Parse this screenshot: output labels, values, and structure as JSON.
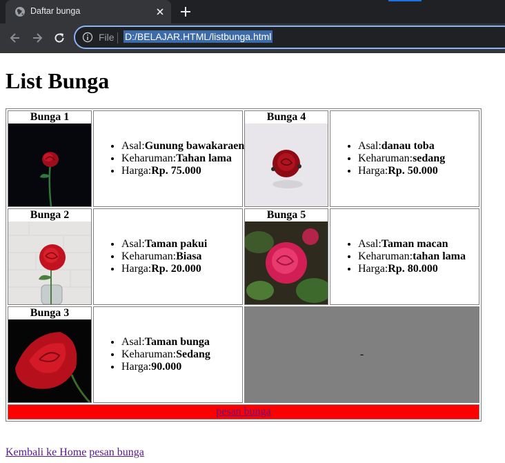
{
  "browser": {
    "tab_title": "Daftar bunga",
    "scheme_label": "File",
    "url": "D:/BELAJAR.HTML/listbunga.html"
  },
  "page": {
    "title": "List Bunga",
    "flowers": [
      {
        "name": "Bunga 1",
        "asal_label": "Asal:",
        "asal": "Gunung bawakaraeng",
        "keharuman_label": "Keharuman:",
        "keharuman": "Tahan lama",
        "harga_label": "Harga:",
        "harga": "Rp. 75.000"
      },
      {
        "name": "Bunga 4",
        "asal_label": "Asal:",
        "asal": "danau toba",
        "keharuman_label": "Keharuman:",
        "keharuman": "sedang",
        "harga_label": "Harga:",
        "harga": "Rp. 50.000"
      },
      {
        "name": "Bunga 2",
        "asal_label": "Asal:",
        "asal": "Taman pakui",
        "keharuman_label": "Keharuman:",
        "keharuman": "Biasa",
        "harga_label": "Harga:",
        "harga": "Rp. 20.000"
      },
      {
        "name": "Bunga 5",
        "asal_label": "Asal:",
        "asal": "Taman macan",
        "keharuman_label": "Keharuman:",
        "keharuman": "tahan lama",
        "harga_label": "Harga:",
        "harga": "Rp. 80.000"
      },
      {
        "name": "Bunga 3",
        "asal_label": "Asal:",
        "asal": "Taman bunga",
        "keharuman_label": "Keharuman:",
        "keharuman": "Sedang",
        "harga_label": "Harga:",
        "harga": "90.000"
      }
    ],
    "empty_cell_text": "-",
    "order_link": "pesan bunga",
    "footer_links": [
      "Kembali ke Home",
      "pesan bunga"
    ]
  },
  "icons": {
    "favicon": "globe-icon",
    "tab_close": "close-icon",
    "new_tab": "plus-icon",
    "back": "arrow-left-icon",
    "forward": "arrow-right-icon",
    "reload": "reload-icon",
    "site_info": "info-icon"
  },
  "colors": {
    "empty_cell_bg": "#808080",
    "order_row_bg": "#ff0000",
    "link": "#551a8b",
    "omnibox_focus": "#8ab4f8"
  }
}
